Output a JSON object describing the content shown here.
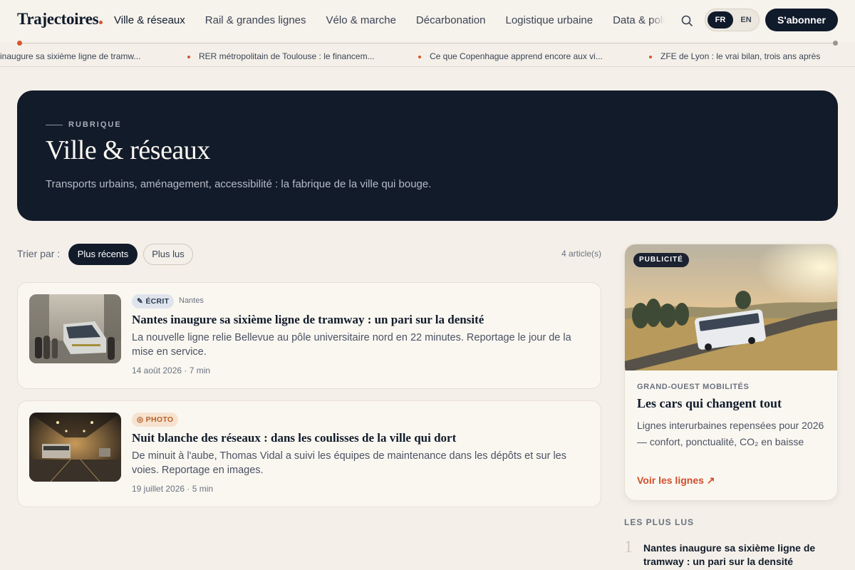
{
  "brand": {
    "name": "Trajectoires"
  },
  "nav": {
    "items": [
      {
        "label": "Ville & réseaux",
        "active": true
      },
      {
        "label": "Rail & grandes lignes"
      },
      {
        "label": "Vélo & marche"
      },
      {
        "label": "Décarbonation"
      },
      {
        "label": "Logistique urbaine"
      },
      {
        "label": "Data & polit"
      }
    ],
    "lang_fr": "FR",
    "lang_en": "EN",
    "subscribe": "S'abonner"
  },
  "ticker": [
    "inaugure sa sixième ligne de tramw...",
    "RER métropolitain de Toulouse : le financem...",
    "Ce que Copenhague apprend encore aux vi...",
    "ZFE de Lyon : le vrai bilan, trois ans après"
  ],
  "hero": {
    "kicker": "RUBRIQUE",
    "title": "Ville & réseaux",
    "subtitle": "Transports urbains, aménagement, accessibilité : la fabrique de la ville qui bouge."
  },
  "sort": {
    "label": "Trier par :",
    "recent": "Plus récents",
    "popular": "Plus lus",
    "count": "4 article(s)"
  },
  "articles": [
    {
      "badge": "✎ ÉCRIT",
      "place": "Nantes",
      "title": "Nantes inaugure sa sixième ligne de tramway : un pari sur la densité",
      "desc": "La nouvelle ligne relie Bellevue au pôle universitaire nord en 22 minutes. Reportage le jour de la mise en service.",
      "meta": "14 août 2026 · 7 min"
    },
    {
      "badge": "◎ PHOTO",
      "place": "",
      "title": "Nuit blanche des réseaux : dans les coulisses de la ville qui dort",
      "desc": "De minuit à l'aube, Thomas Vidal a suivi les équipes de maintenance dans les dépôts et sur les voies. Reportage en images.",
      "meta": "19 juillet 2026 · 5 min"
    }
  ],
  "ad": {
    "badge": "PUBLICITÉ",
    "brand": "GRAND-OUEST MOBILITÉS",
    "title": "Les cars qui changent tout",
    "desc": "Lignes interurbaines repensées pour 2026 — confort, ponctualité, CO₂ en baisse",
    "cta": "Voir les lignes ↗"
  },
  "popular": {
    "heading": "LES PLUS LUS",
    "items": [
      {
        "num": "1",
        "title": "Nantes inaugure sa sixième ligne de tramway : un pari sur la densité"
      }
    ]
  }
}
